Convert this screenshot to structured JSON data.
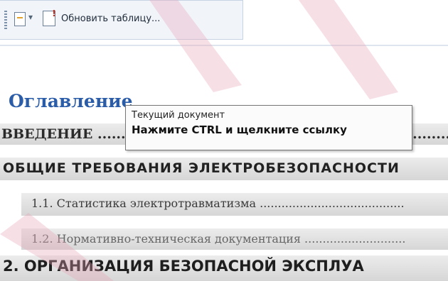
{
  "toolbar": {
    "grip_icon": "toolbar-grip-icon",
    "document_icon": "document-icon",
    "dropdown_icon": "chevron-down-icon",
    "update_table_icon": "update-table-icon",
    "update_table_label": "Обновить таблицу..."
  },
  "toc": {
    "title": "Оглавление",
    "entries": [
      {
        "text": "ВВЕДЕНИЕ ..........................................................................."
      },
      {
        "text": "ОБЩИЕ ТРЕБОВАНИЯ ЭЛЕКТРОБЕЗОПАСНОСТИ"
      },
      {
        "text": "1.1. Статистика электротравматизма ........................................"
      },
      {
        "text": "1.2. Нормативно-техническая документация ............................"
      },
      {
        "text": "2. ОРГАНИЗАЦИЯ БЕЗОПАСНОЙ ЭКСПЛУА"
      }
    ]
  },
  "tooltip": {
    "line1": "Текущий документ",
    "line2": "Нажмите CTRL и щелкните ссылку"
  },
  "colors": {
    "title": "#2a5ca8",
    "tooltip_border": "#767676",
    "watermark": "#e9a3b8"
  }
}
